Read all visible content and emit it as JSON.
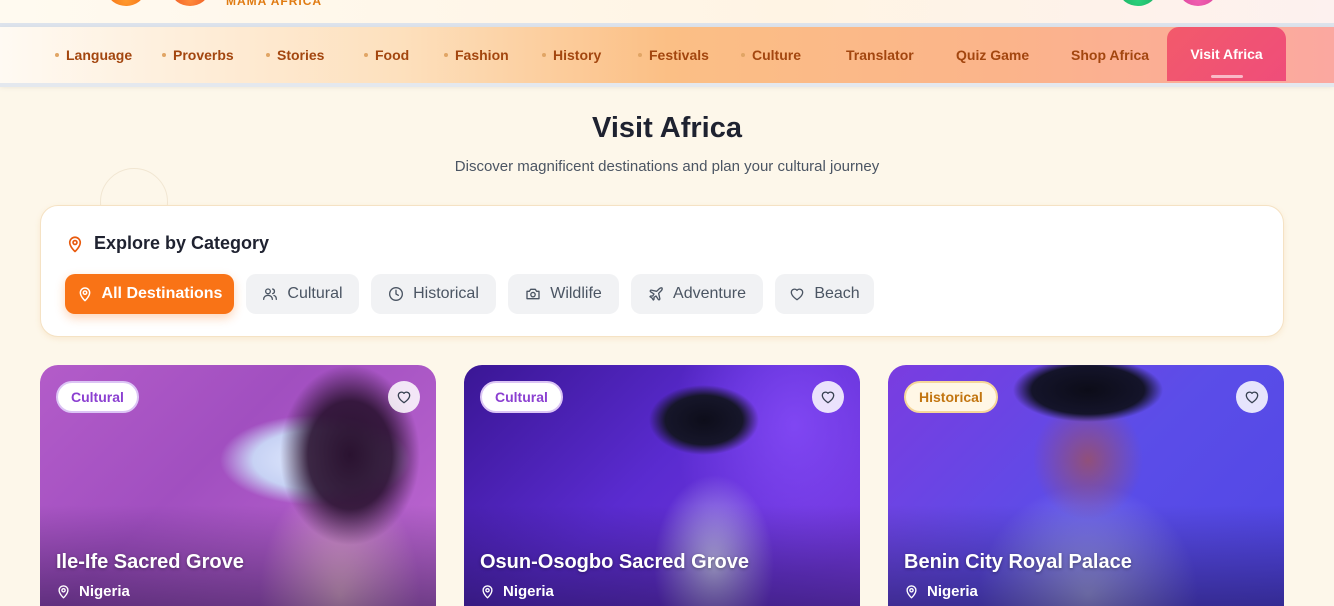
{
  "header": {
    "brand": "MAMA AFRICA"
  },
  "nav": {
    "items": [
      {
        "label": "Language"
      },
      {
        "label": "Proverbs"
      },
      {
        "label": "Stories"
      },
      {
        "label": "Food"
      },
      {
        "label": "Fashion"
      },
      {
        "label": "History"
      },
      {
        "label": "Festivals"
      },
      {
        "label": "Culture"
      },
      {
        "label": "Translator"
      },
      {
        "label": "Quiz Game"
      },
      {
        "label": "Shop Africa"
      },
      {
        "label": "Visit Africa",
        "active": true
      }
    ]
  },
  "page": {
    "title": "Visit Africa",
    "subtitle": "Discover magnificent destinations and plan your cultural journey"
  },
  "categories": {
    "heading": "Explore by Category",
    "filters": [
      {
        "label": "All Destinations",
        "icon": "map-pin-icon",
        "active": true
      },
      {
        "label": "Cultural",
        "icon": "users-icon"
      },
      {
        "label": "Historical",
        "icon": "clock-icon"
      },
      {
        "label": "Wildlife",
        "icon": "camera-icon"
      },
      {
        "label": "Adventure",
        "icon": "plane-icon"
      },
      {
        "label": "Beach",
        "icon": "heart-icon"
      }
    ]
  },
  "destinations": [
    {
      "badge": "Cultural",
      "name": "Ile-Ife Sacred Grove",
      "country": "Nigeria"
    },
    {
      "badge": "Cultural",
      "name": "Osun-Osogbo Sacred Grove",
      "country": "Nigeria"
    },
    {
      "badge": "Historical",
      "name": "Benin City Royal Palace",
      "country": "Nigeria"
    }
  ],
  "colors": {
    "accent": "#f97316",
    "nav_active": "#f25a6b",
    "nav_text": "#a3460f",
    "page_bg": "#fdf7ea"
  }
}
